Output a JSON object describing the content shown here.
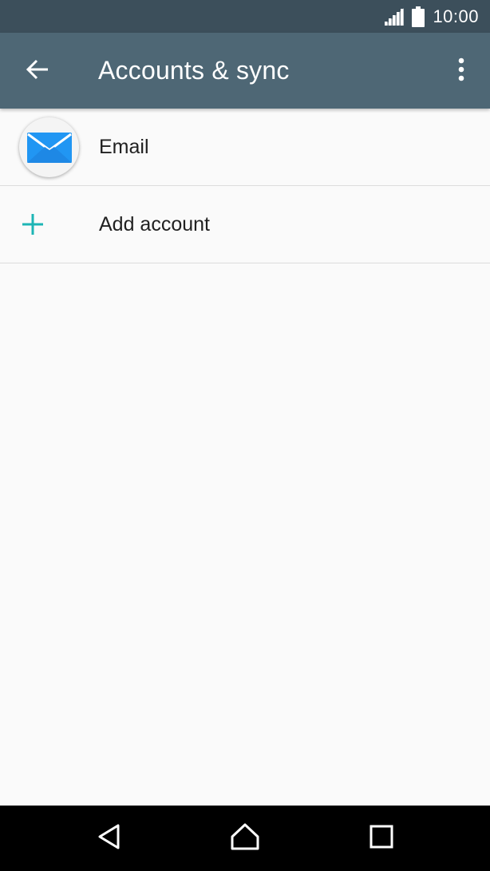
{
  "status_bar": {
    "time": "10:00",
    "icons": [
      "signal-icon",
      "battery-icon"
    ]
  },
  "app_bar": {
    "title": "Accounts & sync",
    "back_icon": "arrow-back-icon",
    "menu_icon": "more-vert-icon"
  },
  "accounts": {
    "items": [
      {
        "label": "Email",
        "icon": "email-envelope-icon"
      },
      {
        "label": "Add account",
        "icon": "plus-icon"
      }
    ]
  },
  "nav_bar": {
    "icons": [
      "nav-back-icon",
      "nav-home-icon",
      "nav-recents-icon"
    ]
  },
  "colors": {
    "status_bar_bg": "#3c4f5b",
    "app_bar_bg": "#4e6775",
    "accent": "#1db5b5",
    "email_blue": "#2196f3",
    "background": "#fafafa"
  }
}
